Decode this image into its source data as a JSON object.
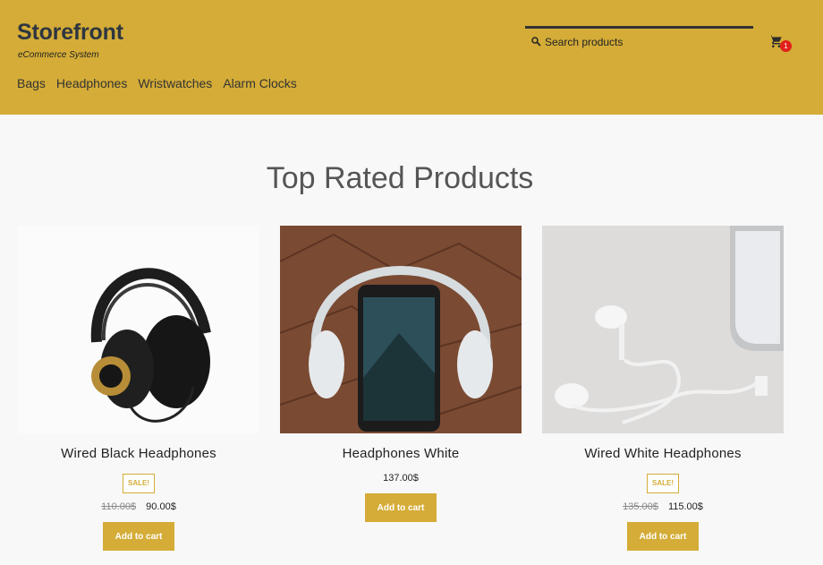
{
  "brand": {
    "title": "Storefront",
    "subtitle": "eCommerce System"
  },
  "nav": {
    "items": [
      "Bags",
      "Headphones",
      "Wristwatches",
      "Alarm Clocks"
    ]
  },
  "search": {
    "placeholder": "Search products"
  },
  "cart": {
    "count": "1"
  },
  "section": {
    "title": "Top Rated Products"
  },
  "products": [
    {
      "name": "Wired Black Headphones",
      "badge": "SALE!",
      "old_price": "110.00$",
      "price": "90.00$",
      "button": "Add to cart"
    },
    {
      "name": "Headphones White",
      "price": "137.00$",
      "button": "Add to cart"
    },
    {
      "name": "Wired White Headphones",
      "badge": "SALE!",
      "old_price": "135.00$",
      "price": "115.00$",
      "button": "Add to cart"
    }
  ],
  "colors": {
    "accent": "#d4ac37",
    "badge": "#e0201b",
    "text": "#333333"
  }
}
